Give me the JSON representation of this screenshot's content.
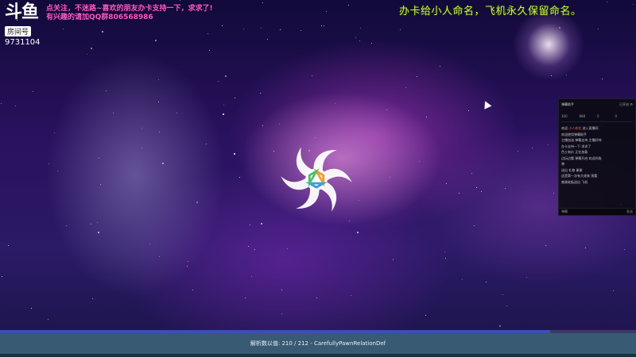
{
  "overlay": {
    "logo_mark": "斗鱼",
    "room_badge": "房间号",
    "room_number": "9731104",
    "notice_line_1": "点关注，不迷路~喜欢的朋友办卡支持一下，求求了!",
    "notice_line_2": "有兴趣的请加QQ群806568986",
    "headline": "办卡给小人命名，飞机永久保留命名。"
  },
  "chat_panel": {
    "title": "弹幕助手",
    "actions": "已开启 ⚙",
    "stats": [
      "100",
      "888",
      "0",
      "0"
    ],
    "lines": [
      {
        "text": "欢迎 ",
        "highlight": "小人命名",
        "rest": " 进入直播间"
      },
      {
        "text": "欢迎使用弹幕助手",
        "highlight": "",
        "rest": ""
      },
      {
        "text": "主播加油 弹幕支持 主播好帅",
        "highlight": "",
        "rest": ""
      },
      {
        "text": "办卡支持一下 求求了",
        "highlight": "",
        "rest": ""
      },
      {
        "text": "色士有价 正在加载",
        "highlight": "",
        "rest": ""
      },
      {
        "text": "边玩边看 弹幕开启 欢迎光临",
        "highlight": "",
        "rest": ""
      },
      {
        "text": "弹",
        "highlight": "",
        "rest": ""
      },
      {
        "text": "送出 礼物 谢谢",
        "highlight": "",
        "rest": ""
      },
      {
        "text": "",
        "highlight": "",
        "rest": ""
      },
      {
        "text": "这是第一次有大佬来 观看",
        "highlight": "",
        "rest": ""
      },
      {
        "text": "感谢老板送出 飞机",
        "highlight": "",
        "rest": ""
      }
    ],
    "footer_left": "弹幕 ",
    "footer_right": "发送"
  },
  "loading": {
    "progress": 0.8645,
    "status_text": "解析数以值: 210 / 212  - CarefullyPawnRelationDef"
  },
  "icons": {
    "emblem": "rimworld-loading-emblem-icon",
    "cursor": "mouse-cursor-icon"
  },
  "colors": {
    "headline": "#c8ff40",
    "notice": "#ff5ad2",
    "status_bar": "#3c6478",
    "progress_fill": "#3a4fb8"
  }
}
